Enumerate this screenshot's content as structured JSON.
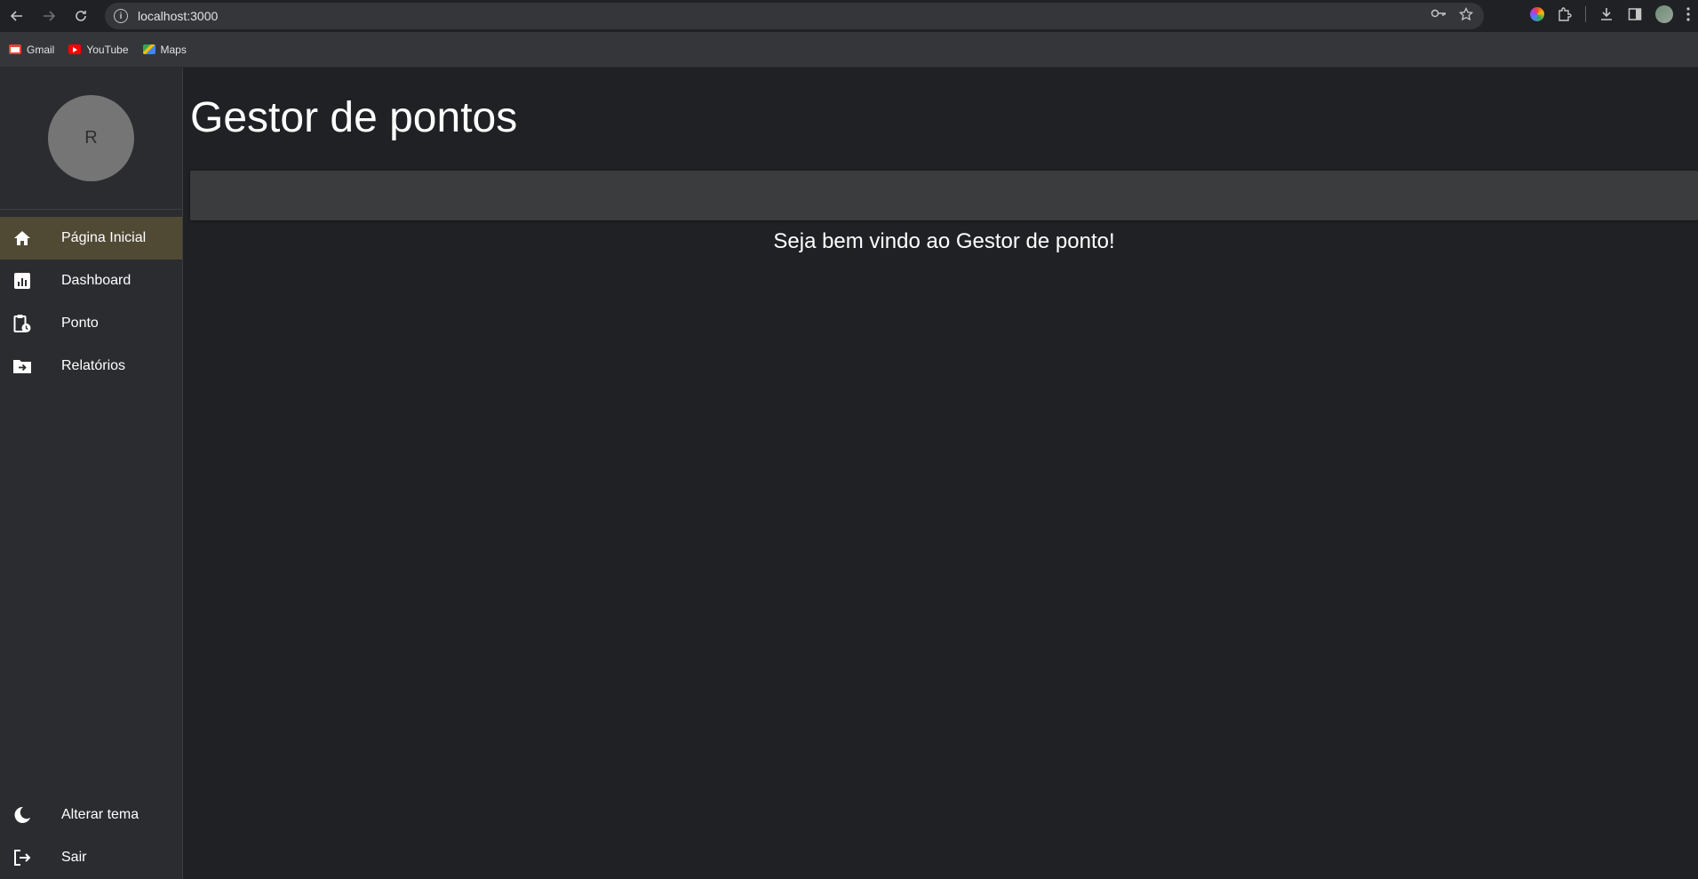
{
  "browser": {
    "url": "localhost:3000",
    "bookmarks": [
      {
        "label": "Gmail"
      },
      {
        "label": "YouTube"
      },
      {
        "label": "Maps"
      }
    ]
  },
  "sidebar": {
    "avatar_letter": "R",
    "items": [
      {
        "label": "Página Inicial",
        "icon": "home-icon",
        "active": true
      },
      {
        "label": "Dashboard",
        "icon": "chart-icon",
        "active": false
      },
      {
        "label": "Ponto",
        "icon": "clipboard-clock-icon",
        "active": false
      },
      {
        "label": "Relatórios",
        "icon": "folder-arrow-icon",
        "active": false
      }
    ],
    "bottom_items": [
      {
        "label": "Alterar tema",
        "icon": "moon-icon"
      },
      {
        "label": "Sair",
        "icon": "logout-icon"
      }
    ]
  },
  "main": {
    "title": "Gestor de pontos",
    "welcome": "Seja bem vindo ao Gestor de ponto!"
  },
  "colors": {
    "background": "#202124",
    "sidebar": "#2b2c2f",
    "active_item": "#504a35",
    "appbar": "#3b3c3e"
  }
}
